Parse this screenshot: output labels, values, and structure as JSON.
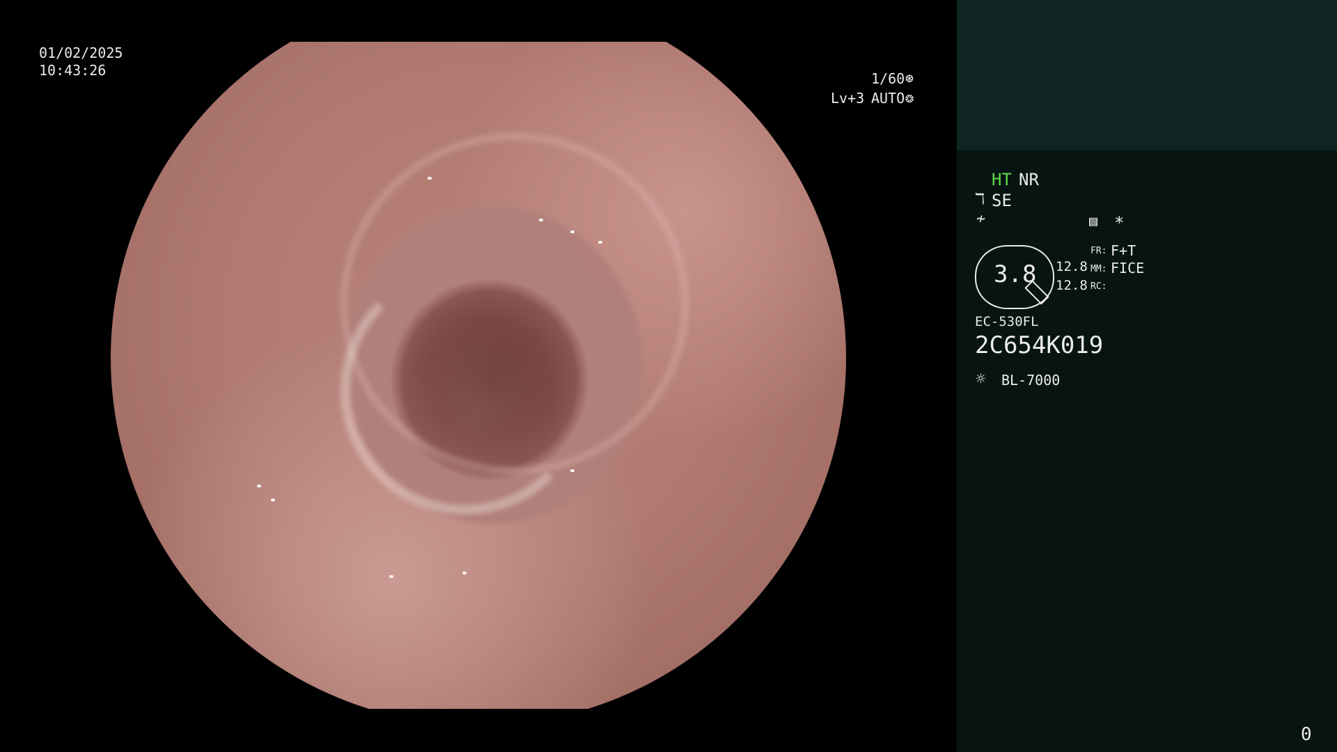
{
  "datetime": {
    "date": "01/02/2025",
    "time": "10:43:26"
  },
  "shutter": {
    "value": "1/60",
    "icon": "shutter-icon"
  },
  "iris": {
    "level": "Lv+3",
    "mode": "AUTO",
    "icon": "iris-icon"
  },
  "status": {
    "ht": "HT",
    "nr": "NR",
    "se_icon": "enhance-icon",
    "se": "SE",
    "filter_icon": "filter-icon",
    "menu_icon": "settings-list-icon",
    "star": "*"
  },
  "lens": {
    "value": "3.8",
    "left_values": [
      "12.8",
      "12.8"
    ],
    "fr_label": "FR:",
    "fr_value": "F+T",
    "mm_label": "MM:",
    "mm_value": "FICE",
    "rc_label": "RC:",
    "rc_value": ""
  },
  "device": {
    "model": "EC-530FL",
    "serial": "2C654K019",
    "light_icon": "light-source-icon",
    "light_source": "BL-7000"
  },
  "counter": "0"
}
